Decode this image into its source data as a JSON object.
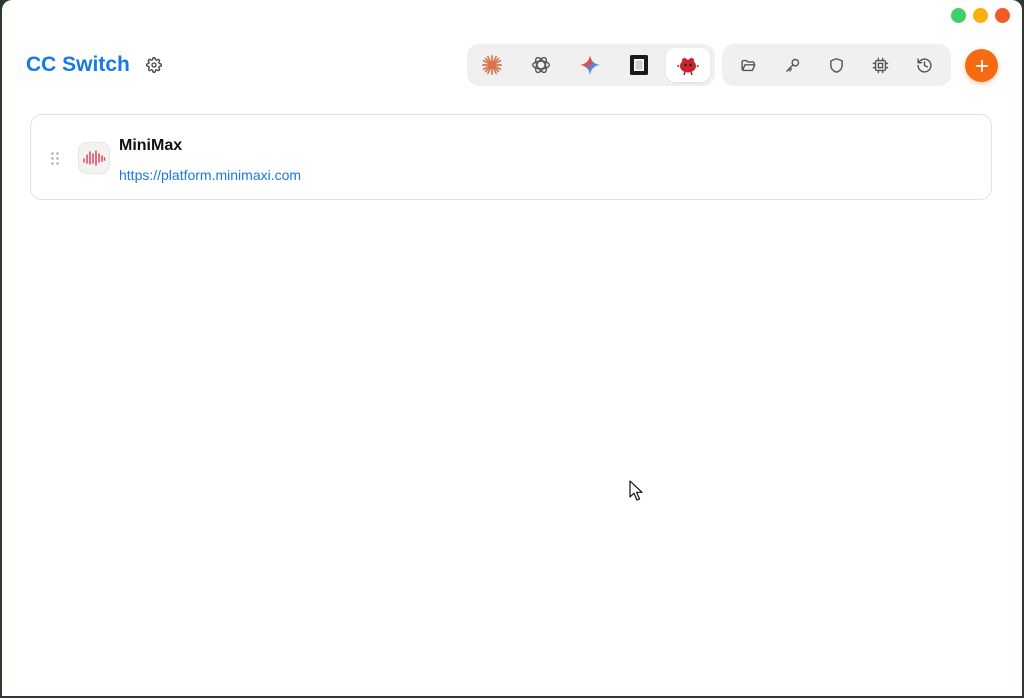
{
  "window": {
    "controls": [
      {
        "name": "window-zoom-button",
        "color": "#3fd06a"
      },
      {
        "name": "window-minimize-button",
        "color": "#f8b00f"
      },
      {
        "name": "window-close-button",
        "color": "#f45a26"
      }
    ]
  },
  "header": {
    "title": "CC Switch",
    "settings_icon": "gear-icon",
    "app_tabs": [
      {
        "id": "claude",
        "icon": "claude-starburst-icon",
        "active": false
      },
      {
        "id": "codex",
        "icon": "openai-knot-icon",
        "active": false
      },
      {
        "id": "gemini",
        "icon": "gemini-sparkle-icon",
        "active": false
      },
      {
        "id": "opencode",
        "icon": "terminal-square-icon",
        "active": false
      },
      {
        "id": "bird",
        "icon": "red-bird-icon",
        "active": true
      }
    ],
    "tools": [
      {
        "id": "folder",
        "icon": "folder-open-icon"
      },
      {
        "id": "key",
        "icon": "key-icon"
      },
      {
        "id": "shield",
        "icon": "shield-icon"
      },
      {
        "id": "chip",
        "icon": "cpu-chip-icon"
      },
      {
        "id": "history",
        "icon": "history-icon"
      }
    ],
    "add_icon": "plus-icon",
    "accent": "#f66b12",
    "brand": "#1779e3"
  },
  "providers": [
    {
      "name": "MiniMax",
      "url": "https://platform.minimaxi.com",
      "icon": "minimax-waveform-icon"
    }
  ]
}
